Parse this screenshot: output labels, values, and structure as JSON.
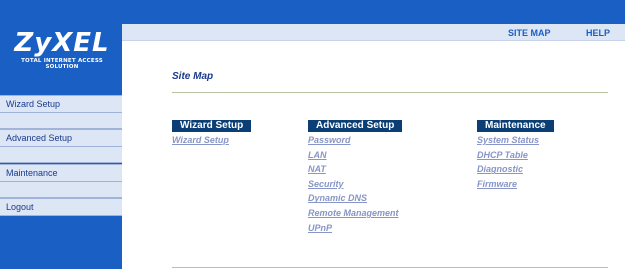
{
  "brand": {
    "name": "ZyXEL",
    "tagline": "TOTAL INTERNET ACCESS SOLUTION"
  },
  "header": {
    "site_map": "SITE MAP",
    "help": "HELP"
  },
  "sidebar": {
    "items": [
      {
        "label": "Wizard Setup"
      },
      {
        "label": "Advanced Setup"
      },
      {
        "label": "Maintenance"
      },
      {
        "label": "Logout"
      }
    ]
  },
  "main": {
    "title": "Site Map",
    "columns": [
      {
        "heading": "Wizard Setup",
        "links": [
          "Wizard Setup"
        ]
      },
      {
        "heading": "Advanced Setup",
        "links": [
          "Password",
          "LAN",
          "NAT",
          "Security",
          "Dynamic DNS",
          "Remote Management",
          "UPnP"
        ]
      },
      {
        "heading": "Maintenance",
        "links": [
          "System Status",
          "DHCP Table",
          "Diagnostic",
          "Firmware"
        ]
      }
    ]
  },
  "colors": {
    "frame_blue": "#1a5fc4",
    "menu_bg": "#dde6f5",
    "heading_bg": "#0b3e74",
    "link": "#8795c7"
  }
}
